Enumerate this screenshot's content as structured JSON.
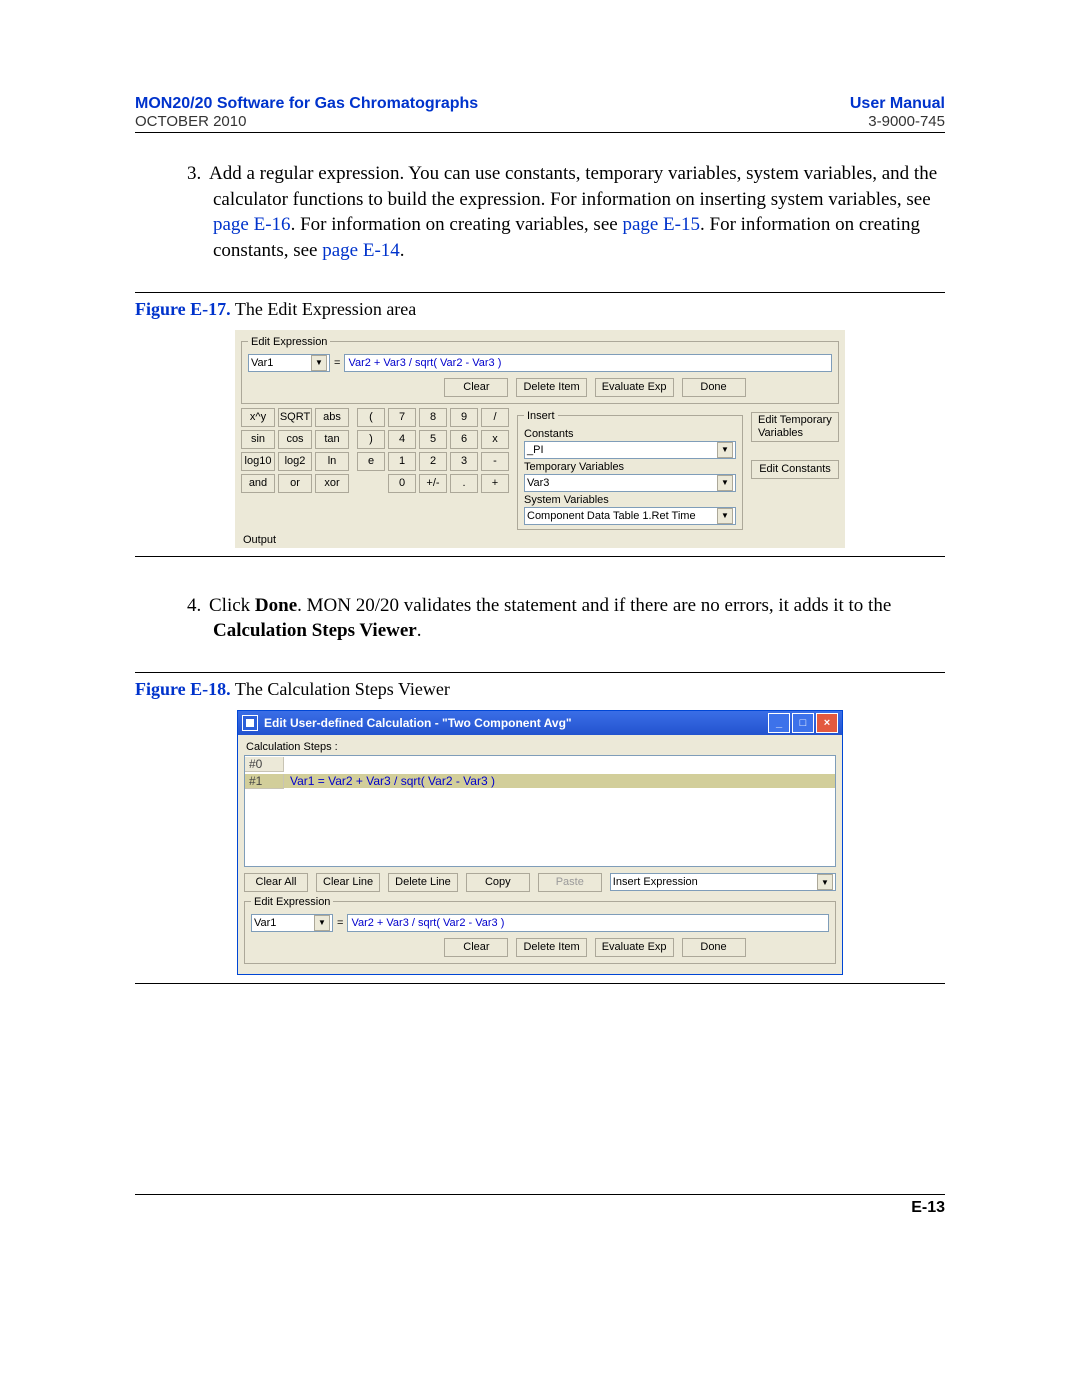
{
  "header": {
    "title_left": "MON20/20 Software for Gas Chromatographs",
    "title_right": "User Manual",
    "sub_left": "OCTOBER 2010",
    "sub_right": "3-9000-745"
  },
  "step3": {
    "num": "3.",
    "text_a": "Add a regular expression.  You can use constants, temporary variables, system variables, and the calculator functions to build the expression.  For information on inserting system variables, see ",
    "link1": "page E-16",
    "text_b": ".  For information on creating variables, see ",
    "link2": "page E-15",
    "text_c": ".  For information on creating constants, see ",
    "link3": "page E-14",
    "text_d": "."
  },
  "figure1": {
    "label": "Figure E-17.",
    "caption": "  The Edit Expression area",
    "groupbox_title": "Edit Expression",
    "var_combo": "Var1",
    "equals": "=",
    "formula": "Var2 + Var3 / sqrt( Var2 - Var3 )",
    "btn_clear": "Clear",
    "btn_delete": "Delete Item",
    "btn_eval": "Evaluate Exp",
    "btn_done": "Done",
    "calc_btns": [
      "x^y",
      "SQRT",
      "abs",
      "sin",
      "cos",
      "tan",
      "log10",
      "log2",
      "ln",
      "and",
      "or",
      "xor"
    ],
    "pad": [
      [
        "(",
        "7",
        "8",
        "9",
        "/"
      ],
      [
        ")",
        "4",
        "5",
        "6",
        "x"
      ],
      [
        "e",
        "1",
        "2",
        "3",
        "-"
      ],
      [
        "",
        "0",
        "+/-",
        ".",
        "+"
      ]
    ],
    "insert_title": "Insert",
    "constants_label": "Constants",
    "constants_value": "_PI",
    "tempvars_label": "Temporary Variables",
    "tempvars_value": "Var3",
    "sysvars_label": "System Variables",
    "sysvars_value": "Component Data Table 1.Ret Time",
    "btn_edit_temp": "Edit Temporary Variables",
    "btn_edit_const": "Edit Constants",
    "output_label": "Output"
  },
  "step4": {
    "num": "4.",
    "text_a": "Click ",
    "bold1": "Done",
    "text_b": ".  MON 20/20 validates the statement and if there are no errors, it adds it to the ",
    "bold2": "Calculation Steps Viewer",
    "text_c": "."
  },
  "figure2": {
    "label": "Figure E-18.",
    "caption": "  The Calculation Steps Viewer",
    "window_title": "Edit User-defined Calculation - \"Two Component Avg\"",
    "steps_label": "Calculation Steps :",
    "rows": [
      {
        "num": "#0",
        "text": ""
      },
      {
        "num": "#1",
        "text": "Var1  =  Var2 + Var3 / sqrt( Var2 - Var3 )"
      }
    ],
    "btn_clear_all": "Clear All",
    "btn_clear_line": "Clear Line",
    "btn_delete_line": "Delete Line",
    "btn_copy": "Copy",
    "btn_paste": "Paste",
    "insert_combo": "Insert Expression",
    "edit_group_title": "Edit Expression",
    "var_combo": "Var1",
    "equals": "=",
    "formula": "Var2 + Var3 / sqrt( Var2 - Var3 )",
    "btn_clear": "Clear",
    "btn_delete": "Delete Item",
    "btn_eval": "Evaluate Exp",
    "btn_done": "Done"
  },
  "page_number": "E-13"
}
